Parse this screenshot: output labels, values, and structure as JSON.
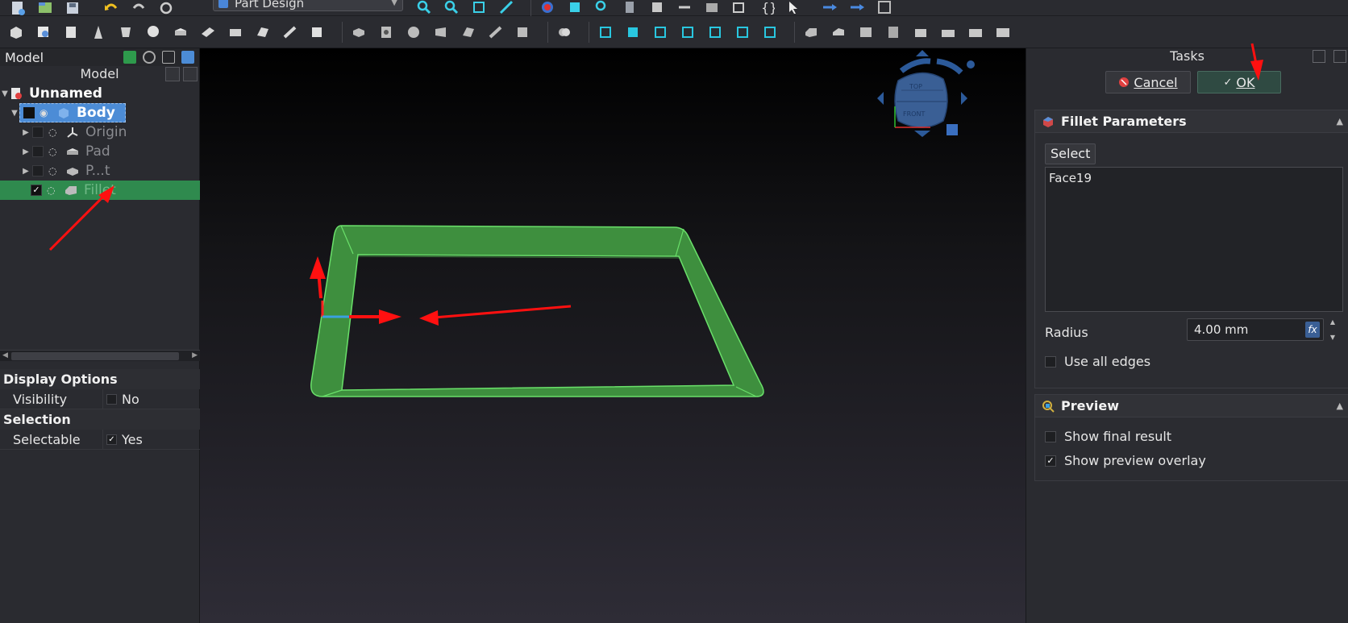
{
  "toolbar": {
    "workbench": "Part Design"
  },
  "combo": {
    "tab_label": "Model",
    "model_title": "Model"
  },
  "tree": {
    "document": "Unnamed",
    "body": "Body",
    "items": [
      {
        "label": "Origin"
      },
      {
        "label": "Pad"
      },
      {
        "label": "P...t"
      },
      {
        "label": "Fillet"
      }
    ]
  },
  "properties": {
    "groups": [
      {
        "title": "Display Options",
        "key": "Visibility",
        "value": "No",
        "checked": false
      },
      {
        "title": "Selection",
        "key": "Selectable",
        "value": "Yes",
        "checked": true
      }
    ]
  },
  "navcube": {
    "top": "TOP",
    "front": "FRONT"
  },
  "tasks": {
    "title": "Tasks",
    "cancel": "Cancel",
    "ok": "OK",
    "fillet": {
      "title": "Fillet Parameters",
      "select_label": "Select",
      "faces": [
        "Face19"
      ],
      "radius_label": "Radius",
      "radius_value": "4.00 mm",
      "use_all_edges": "Use all edges"
    },
    "preview": {
      "title": "Preview",
      "show_final": "Show final result",
      "show_overlay": "Show preview overlay"
    }
  },
  "colors": {
    "accent_blue": "#4c8cd6",
    "selection_green": "#2f8a4e",
    "annotation_red": "#ff1010",
    "model_green": "#4bb34b"
  }
}
